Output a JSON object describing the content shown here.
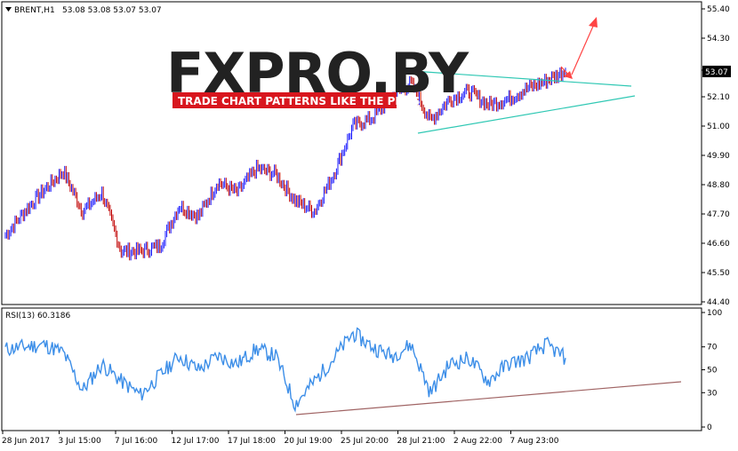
{
  "header": {
    "symbol_label": "BRENT,H1",
    "ohlc_values": "53.08 53.08 53.07 53.07"
  },
  "logo": {
    "main_text": "FXPRO.BY",
    "tagline": "TRADE CHART PATTERNS LIKE THE PROS"
  },
  "icons": {
    "symbol_marker": "triangle-down-icon"
  },
  "colors": {
    "candle_up": "#1a1aff",
    "candle_down": "#c00000",
    "trendline": "#30c8b4",
    "rsi_line": "#3c8ee8",
    "rsi_support": "#a06464",
    "arrow": "#ff4444",
    "logo_band": "#d8161e",
    "current_price_bg": "#000000"
  },
  "price_axis": {
    "ticks": [
      "55.40",
      "54.30",
      "53.10",
      "52.10",
      "51.00",
      "49.90",
      "48.80",
      "47.70",
      "46.60",
      "45.50",
      "44.40"
    ],
    "current_price": "53.07"
  },
  "time_axis": {
    "ticks": [
      "28 Jun 2017",
      "3 Jul 15:00",
      "7 Jul 16:00",
      "12 Jul 17:00",
      "17 Jul 18:00",
      "20 Jul 19:00",
      "25 Jul 20:00",
      "28 Jul 21:00",
      "2 Aug 22:00",
      "7 Aug 23:00"
    ]
  },
  "rsi": {
    "label": "RSI(13) 60.3186",
    "ticks": [
      "100",
      "70",
      "50",
      "30",
      "0"
    ]
  },
  "chart_data": [
    {
      "type": "line",
      "series": [
        {
          "values": [
            [
              "28 Jun 2017",
              46.9
            ],
            [
              "29 Jun",
              47.8
            ],
            [
              "30 Jun",
              48.6
            ],
            [
              "3 Jul 15:00",
              49.3
            ],
            [
              "5 Jul",
              47.8
            ],
            [
              "6 Jul",
              48.5
            ],
            [
              "7 Jul 16:00",
              46.3
            ],
            [
              "10 Jul",
              46.3
            ],
            [
              "11 Jul",
              46.5
            ],
            [
              "12 Jul 17:00",
              48.0
            ],
            [
              "13 Jul",
              47.6
            ],
            [
              "14 Jul",
              48.9
            ],
            [
              "17 Jul 18:00",
              48.5
            ],
            [
              "18 Jul",
              49.4
            ],
            [
              "19 Jul",
              49.2
            ],
            [
              "20 Jul 19:00",
              48.2
            ],
            [
              "21 Jul",
              47.8
            ],
            [
              "24 Jul",
              49.2
            ],
            [
              "25 Jul 20:00",
              51.0
            ],
            [
              "26 Jul",
              51.3
            ],
            [
              "27 Jul",
              52.1
            ],
            [
              "28 Jul 21:00",
              52.6
            ],
            [
              "31 Jul",
              51.2
            ],
            [
              "1 Aug",
              52.0
            ],
            [
              "2 Aug 22:00",
              52.3
            ],
            [
              "3 Aug",
              51.8
            ],
            [
              "4 Aug",
              52.0
            ],
            [
              "7 Aug 23:00",
              52.4
            ],
            [
              "8 Aug",
              52.7
            ],
            [
              "9 Aug",
              53.07
            ]
          ]
        }
      ],
      "ylim": [
        44.4,
        55.4
      ]
    },
    {
      "type": "line",
      "series": [
        {
          "values": [
            [
              "28 Jun 2017",
              68
            ],
            [
              "29 Jun",
              70
            ],
            [
              "30 Jun",
              72
            ],
            [
              "3 Jul 15:00",
              65
            ],
            [
              "5 Jul",
              32
            ],
            [
              "6 Jul",
              55
            ],
            [
              "7 Jul 16:00",
              40
            ],
            [
              "10 Jul",
              28
            ],
            [
              "11 Jul",
              45
            ],
            [
              "12 Jul 17:00",
              62
            ],
            [
              "13 Jul",
              50
            ],
            [
              "14 Jul",
              62
            ],
            [
              "17 Jul 18:00",
              55
            ],
            [
              "18 Jul",
              68
            ],
            [
              "19 Jul",
              62
            ],
            [
              "20 Jul 19:00",
              20
            ],
            [
              "21 Jul",
              40
            ],
            [
              "24 Jul",
              60
            ],
            [
              "25 Jul 20:00",
              82
            ],
            [
              "26 Jul",
              70
            ],
            [
              "27 Jul",
              62
            ],
            [
              "28 Jul 21:00",
              72
            ],
            [
              "31 Jul",
              30
            ],
            [
              "1 Aug",
              55
            ],
            [
              "2 Aug 22:00",
              60
            ],
            [
              "3 Aug",
              40
            ],
            [
              "4 Aug",
              55
            ],
            [
              "7 Aug 23:00",
              60
            ],
            [
              "8 Aug",
              72
            ],
            [
              "9 Aug",
              60.3
            ]
          ]
        }
      ],
      "ylim": [
        0,
        100
      ]
    }
  ]
}
